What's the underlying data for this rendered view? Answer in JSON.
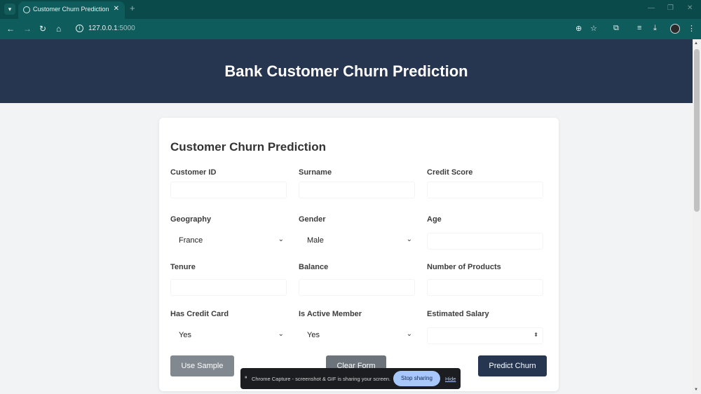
{
  "browser": {
    "tab_title": "Customer Churn Prediction",
    "url_host": "127.0.0.1",
    "url_port": ":5000"
  },
  "page": {
    "header_title": "Bank Customer Churn Prediction",
    "form_title": "Customer Churn Prediction",
    "fields": {
      "customer_id": "Customer ID",
      "surname": "Surname",
      "credit_score": "Credit Score",
      "geography": "Geography",
      "gender": "Gender",
      "age": "Age",
      "tenure": "Tenure",
      "balance": "Balance",
      "num_products": "Number of Products",
      "has_credit_card": "Has Credit Card",
      "is_active_member": "Is Active Member",
      "estimated_salary": "Estimated Salary"
    },
    "values": {
      "geography": "France",
      "gender": "Male",
      "has_credit_card": "Yes",
      "is_active_member": "Yes"
    },
    "buttons": {
      "use_sample": "Use Sample",
      "clear_form": "Clear Form",
      "predict": "Predict Churn"
    }
  },
  "share_bar": {
    "message": "Chrome Capture - screenshot & GIF is sharing your screen.",
    "stop_label": "Stop sharing",
    "hide_label": "Hide"
  }
}
